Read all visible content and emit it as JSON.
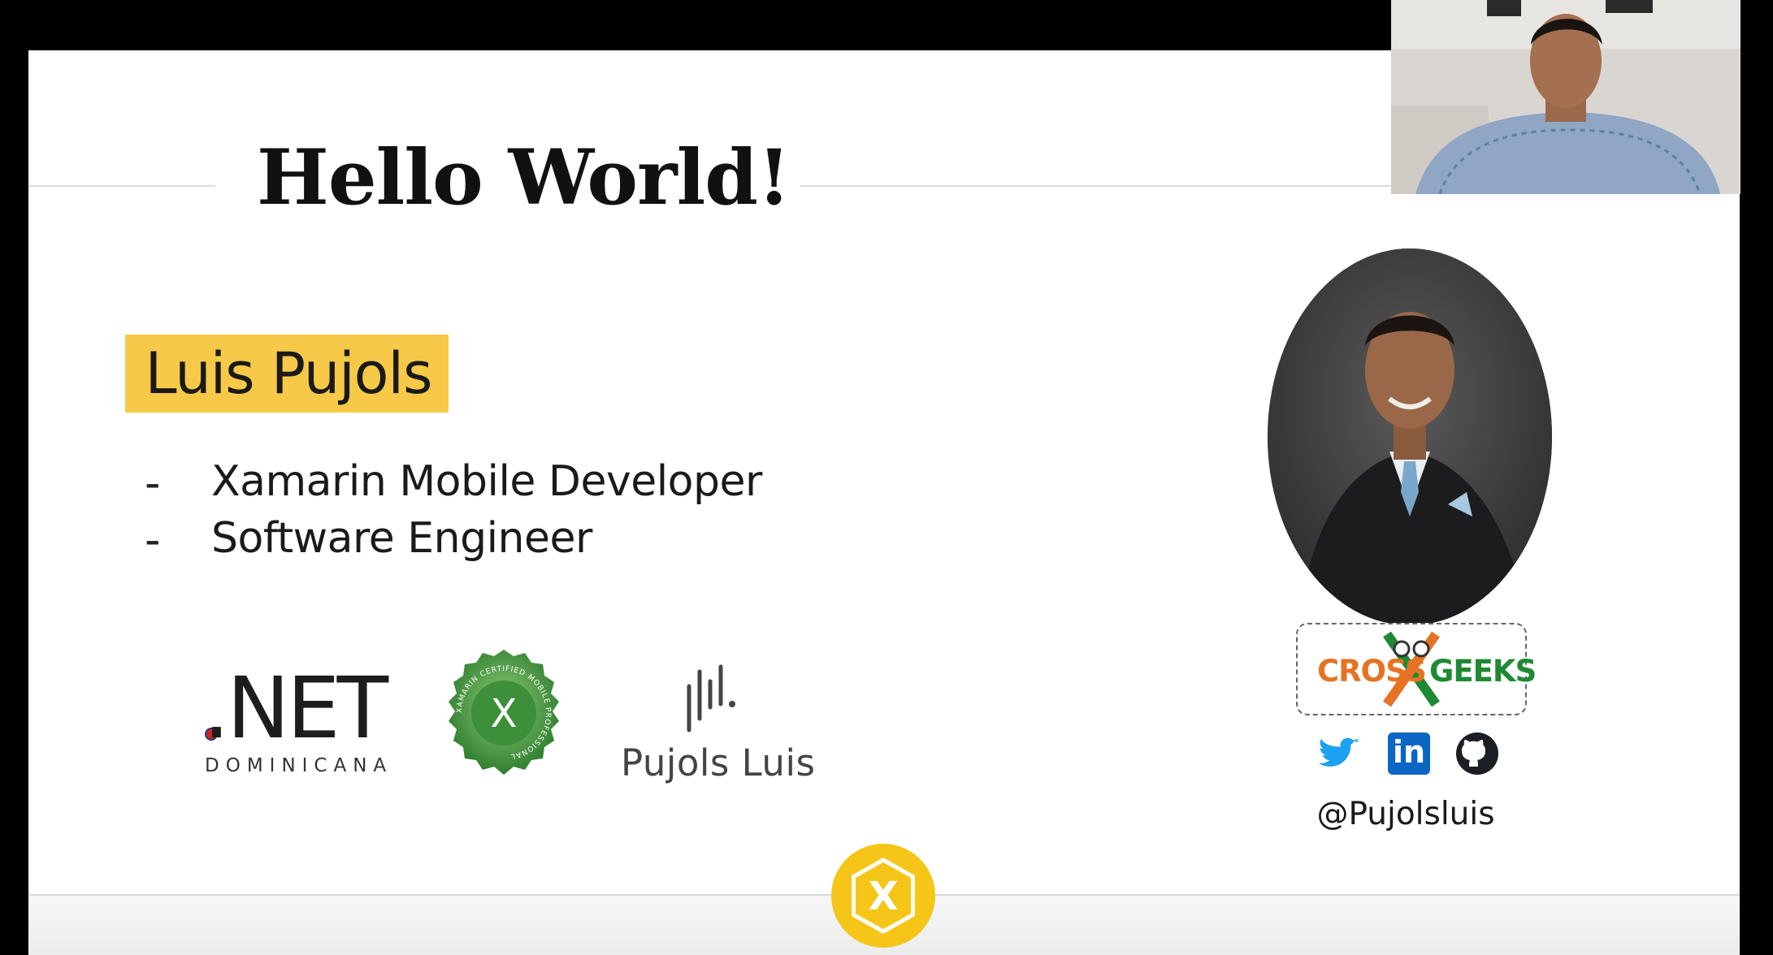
{
  "slide": {
    "title": "Hello World!",
    "name": "Luis Pujols",
    "roles": [
      "Xamarin Mobile Developer",
      "Software Engineer"
    ],
    "role_dash": "-"
  },
  "logos": {
    "net": {
      "main": ".NET",
      "sub": "DOMINICANA"
    },
    "xamarin_badge": {
      "letter": "X",
      "ring_text": "XAMARIN CERTIFIED MOBILE PROFESSIONAL"
    },
    "pujols": {
      "text": "Pujols Luis"
    },
    "cross_geeks": {
      "left": "CROSS",
      "right": "GEEKS"
    },
    "footer_logo": {
      "letter": "X"
    }
  },
  "social": {
    "icons": [
      "twitter-icon",
      "linkedin-icon",
      "github-icon"
    ],
    "linkedin_text": "in",
    "handle": "@Pujolsluis"
  },
  "colors": {
    "highlight": "#f7c948",
    "xamarin_yellow": "#f5c518",
    "twitter": "#1da1f2",
    "linkedin": "#0a66c2",
    "badge_green": "#3c9a3c",
    "cross_orange": "#e67324",
    "geeks_green": "#1e8a34"
  }
}
